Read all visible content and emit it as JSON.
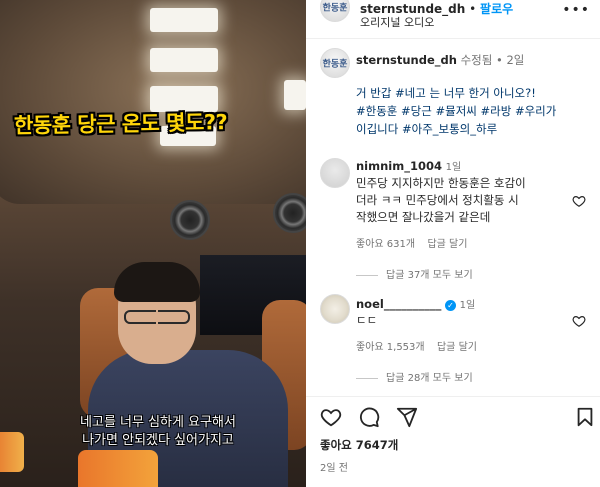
{
  "header": {
    "username": "sternstunde_dh",
    "separator": "•",
    "follow_label": "팔로우",
    "subtitle": "오리지널 오디오",
    "avatar_text": "한동훈",
    "more_label": "•••"
  },
  "caption": {
    "username": "sternstunde_dh",
    "edited": "수정됨",
    "separator": "•",
    "time": "2일",
    "avatar_text": "한동훈",
    "lines": [
      "거 반갑 #네고 는 너무 한거 아니오?!",
      "#한동훈 #당근 #뮬저씨 #라방 #우리가",
      "이깁니다 #아주_보통의_하루"
    ]
  },
  "comments": [
    {
      "username": "nimnim_1004",
      "time": "1일",
      "lines": [
        "민주당 지지하지만 한동훈은 호감이",
        "더라 ㅋㅋ 민주당에서 정치활동 시",
        "작했으면 잘나갔을거 같은데"
      ],
      "likes": "좋아요 631개",
      "reply_label": "답글 달기",
      "view_replies": "답글 37개 모두 보기"
    },
    {
      "username": "noel__________",
      "verified": true,
      "time": "1일",
      "lines": [
        "ㄷㄷ"
      ],
      "likes": "좋아요 1,553개",
      "reply_label": "답글 달기",
      "view_replies": "답글 28개 모두 보기"
    }
  ],
  "post": {
    "likes": "좋아요 7647개",
    "posted_ago": "2일 전"
  },
  "video": {
    "overlay_title": "한동훈 당근 온도 몇도??",
    "subtitle_lines": [
      "네고를 너무 심하게 요구해서",
      "나가면 안되겠다 싶어가지고"
    ]
  },
  "icons": {
    "like": "heart-icon",
    "comment": "comment-icon",
    "share": "share-icon",
    "save": "bookmark-icon",
    "more": "more-icon"
  }
}
